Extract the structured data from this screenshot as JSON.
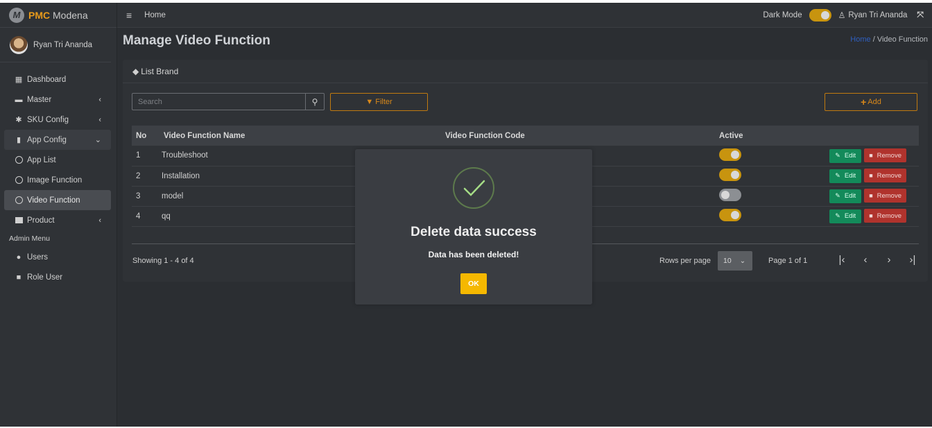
{
  "brand": {
    "logo_letter": "M",
    "name_bold": "PMC",
    "name_rest": " Modena"
  },
  "sidebar": {
    "user_name": "Ryan Tri Ananda",
    "items": [
      {
        "label": "Dashboard"
      },
      {
        "label": "Master"
      },
      {
        "label": "SKU Config"
      },
      {
        "label": "App Config"
      },
      {
        "label": "App List"
      },
      {
        "label": "Image Function"
      },
      {
        "label": "Video Function"
      },
      {
        "label": "Product"
      }
    ],
    "admin_header": "Admin Menu",
    "admin_items": [
      {
        "label": "Users"
      },
      {
        "label": "Role User"
      }
    ]
  },
  "topbar": {
    "home": "Home",
    "dark_mode_label": "Dark Mode",
    "user_name": "Ryan Tri Ananda"
  },
  "page": {
    "title": "Manage Video Function",
    "breadcrumb_home": "Home",
    "breadcrumb_sep": " / ",
    "breadcrumb_current": "Video Function"
  },
  "card": {
    "title": "List Brand",
    "search_placeholder": "Search",
    "filter_label": "Filter",
    "add_label": "Add"
  },
  "table": {
    "headers": {
      "no": "No",
      "name": "Video Function Name",
      "code": "Video Function Code",
      "active": "Active"
    },
    "rows": [
      {
        "no": "1",
        "name": "Troubleshoot",
        "code": "",
        "active": true
      },
      {
        "no": "2",
        "name": "Installation",
        "code": "",
        "active": true
      },
      {
        "no": "3",
        "name": "model",
        "code": "",
        "active": false
      },
      {
        "no": "4",
        "name": "qq",
        "code": "",
        "active": true
      }
    ],
    "edit_label": "Edit",
    "remove_label": "Remove"
  },
  "footer": {
    "showing": "Showing 1 - 4 of 4",
    "rows_per_page_label": "Rows per page",
    "rows_per_page_value": "10",
    "page_label": "Page 1 of 1"
  },
  "modal": {
    "title": "Delete data success",
    "text": "Data has been deleted!",
    "ok_label": "OK"
  },
  "colors": {
    "accent": "#e89a1b",
    "toggle_on": "#c8940f",
    "edit": "#138a5a",
    "remove": "#b0332d",
    "ok": "#f5b800"
  }
}
